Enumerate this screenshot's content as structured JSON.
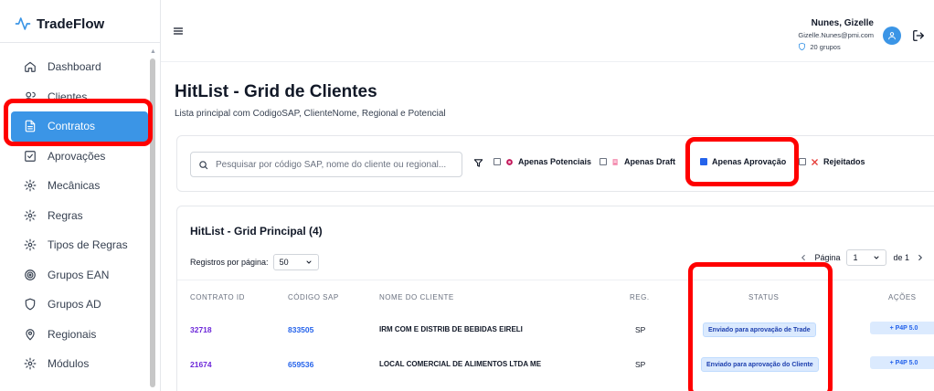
{
  "app": {
    "brand": "TradeFlow"
  },
  "sidebar": {
    "items": [
      {
        "label": "Dashboard",
        "icon": "home-icon",
        "active": false
      },
      {
        "label": "Clientes",
        "icon": "users-icon",
        "active": false
      },
      {
        "label": "Contratos",
        "icon": "document-icon",
        "active": true
      },
      {
        "label": "Aprovações",
        "icon": "check-square-icon",
        "active": false
      },
      {
        "label": "Mecânicas",
        "icon": "gear-icon",
        "active": false
      },
      {
        "label": "Regras",
        "icon": "gear-icon",
        "active": false
      },
      {
        "label": "Tipos de Regras",
        "icon": "gear-icon",
        "active": false
      },
      {
        "label": "Grupos EAN",
        "icon": "target-icon",
        "active": false
      },
      {
        "label": "Grupos AD",
        "icon": "shield-icon",
        "active": false
      },
      {
        "label": "Regionais",
        "icon": "map-pin-icon",
        "active": false
      },
      {
        "label": "Módulos",
        "icon": "gear-icon",
        "active": false
      }
    ]
  },
  "header": {
    "user_name": "Nunes, Gizelle",
    "user_email": "Gizelle.Nunes@pmi.com",
    "groups": "20 grupos"
  },
  "page": {
    "title": "HitList - Grid de Clientes",
    "subtitle": "Lista principal com CodigoSAP, ClienteNome, Regional e Potencial"
  },
  "filters": {
    "search_placeholder": "Pesquisar por código SAP, nome do cliente ou regional...",
    "options": [
      {
        "label": "Apenas Potenciais",
        "checked": false
      },
      {
        "label": "Apenas Draft",
        "checked": false
      },
      {
        "label": "Apenas Aprovação",
        "checked": true
      },
      {
        "label": "Rejeitados",
        "checked": false
      }
    ]
  },
  "grid": {
    "title": "HitList - Grid Principal (4)",
    "per_page_label": "Registros por página:",
    "per_page_value": "50",
    "page_label": "Página",
    "page_value": "1",
    "page_total": "de 1",
    "columns": [
      "CONTRATO ID",
      "CÓDIGO SAP",
      "NOME DO CLIENTE",
      "REG.",
      "STATUS",
      "AÇÕES"
    ],
    "rows": [
      {
        "contrato_id": "32718",
        "codigo_sap": "833505",
        "nome": "IRM COM E DISTRIB DE BEBIDAS EIRELI",
        "reg": "SP",
        "status": "Enviado para aprovação de Trade",
        "acao": "+ P4P 5.0"
      },
      {
        "contrato_id": "21674",
        "codigo_sap": "659536",
        "nome": "LOCAL COMERCIAL DE ALIMENTOS LTDA ME",
        "reg": "SP",
        "status": "Enviado para aprovação do Cliente",
        "acao": "+ P4P 5.0"
      }
    ]
  },
  "colors": {
    "accent": "#3b95e6",
    "annotation": "#ff0000"
  }
}
